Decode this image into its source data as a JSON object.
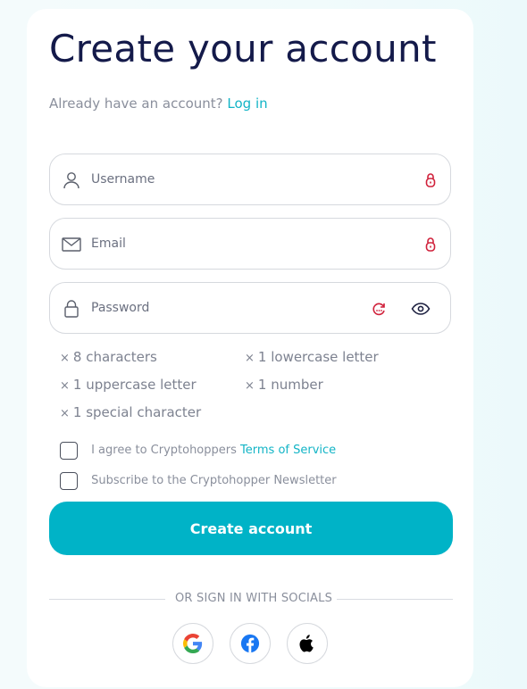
{
  "heading": "Create your account",
  "login_prompt": {
    "text": "Already have an account?",
    "link": "Log in"
  },
  "fields": {
    "username": {
      "placeholder": "Username",
      "value": ""
    },
    "email": {
      "placeholder": "Email",
      "value": ""
    },
    "password": {
      "placeholder": "Password",
      "value": ""
    }
  },
  "password_requirements": [
    {
      "mark": "×",
      "label": "8 characters"
    },
    {
      "mark": "×",
      "label": "1 lowercase letter"
    },
    {
      "mark": "×",
      "label": "1 uppercase letter"
    },
    {
      "mark": "×",
      "label": "1 number"
    },
    {
      "mark": "×",
      "label": "1 special character"
    }
  ],
  "terms": {
    "text": "I agree to Cryptohoppers",
    "link": "Terms of Service"
  },
  "newsletter": {
    "text": "Subscribe to the Cryptohopper Newsletter"
  },
  "submit_label": "Create account",
  "social_divider": "OR SIGN IN WITH SOCIALS",
  "social_providers": [
    "google-icon",
    "facebook-icon",
    "apple-icon"
  ],
  "colors": {
    "accent": "#00b3c7",
    "link": "#12b4c6",
    "heading": "#141a4a",
    "lock_icon": "#d0213b"
  }
}
